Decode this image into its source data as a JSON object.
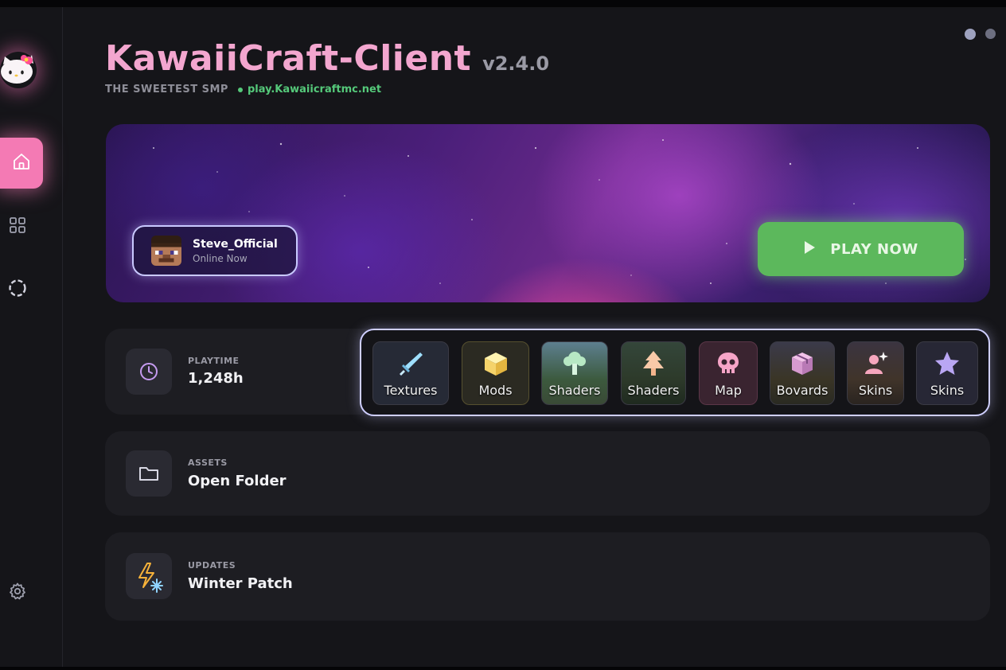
{
  "app": {
    "title": "KawaiiCraft-Client",
    "version": "v2.4.0",
    "tagline": "THE SWEETEST SMP",
    "server": "play.Kawaiicraftmc.net"
  },
  "sidebar": {
    "items": [
      {
        "name": "home",
        "icon": "home-icon",
        "active": true
      },
      {
        "name": "grid",
        "icon": "grid-icon",
        "active": false
      },
      {
        "name": "sync",
        "icon": "sync-icon",
        "active": false
      },
      {
        "name": "settings",
        "icon": "gear-icon",
        "active": false
      }
    ]
  },
  "hero": {
    "user_name": "Steve_Official",
    "user_status": "Online Now",
    "play_label": "PLAY NOW"
  },
  "stats": {
    "playtime_label": "PLAYTIME",
    "playtime_value": "1,248h",
    "assets_label": "ASSETS",
    "assets_value": "Open Folder",
    "updates_label": "UPDATES",
    "updates_value": "Winter Patch"
  },
  "tools": [
    {
      "label": "Textures",
      "icon": "sword-icon"
    },
    {
      "label": "Mods",
      "icon": "cube-icon"
    },
    {
      "label": "Shaders",
      "icon": "tree-icon"
    },
    {
      "label": "Shaders",
      "icon": "pine-tree-icon"
    },
    {
      "label": "Map",
      "icon": "skull-icon"
    },
    {
      "label": "Bovards",
      "icon": "package-icon"
    },
    {
      "label": "Skins",
      "icon": "user-sparkle-icon"
    },
    {
      "label": "Skins",
      "icon": "star-icon"
    }
  ],
  "colors": {
    "accent": "#f47ab4",
    "title": "#f3a6cf",
    "play": "#5cb85c",
    "server": "#55c97a",
    "background": "#151519"
  }
}
